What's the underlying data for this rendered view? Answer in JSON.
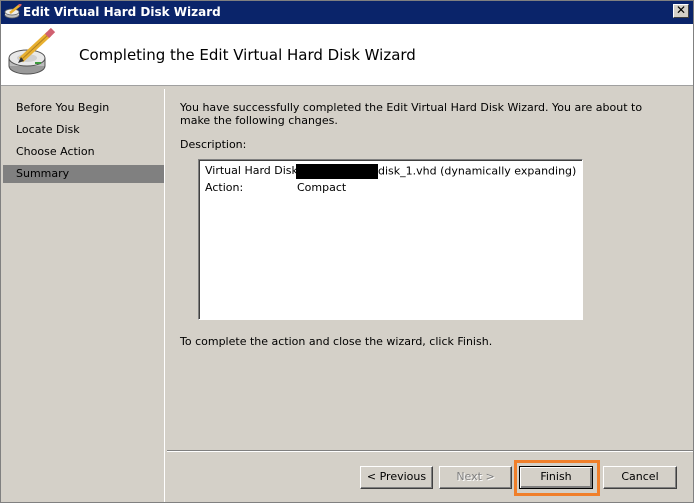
{
  "window": {
    "title": "Edit Virtual Hard Disk Wizard",
    "close_glyph": "✕"
  },
  "header": {
    "heading": "Completing the Edit Virtual Hard Disk Wizard"
  },
  "nav": {
    "items": [
      {
        "label": "Before You Begin",
        "selected": false
      },
      {
        "label": "Locate Disk",
        "selected": false
      },
      {
        "label": "Choose Action",
        "selected": false
      },
      {
        "label": "Summary",
        "selected": true
      }
    ]
  },
  "content": {
    "intro": "You have successfully completed the Edit Virtual Hard Disk Wizard. You are about to make the following changes.",
    "description_label": "Description:",
    "description": {
      "vhd_label": "Virtual Hard Disk:",
      "vhd_value_suffix": "disk_1.vhd (dynamically expanding)",
      "action_label": "Action:",
      "action_value": "Compact"
    },
    "footer_note": "To complete the action and close the wizard, click Finish."
  },
  "buttons": {
    "previous": "< Previous",
    "next": "Next >",
    "finish": "Finish",
    "cancel": "Cancel"
  },
  "colors": {
    "titlebar": "#0a246a",
    "highlight": "#f07f2a",
    "selected_nav": "#808080"
  },
  "icons": {
    "title_icon": "disk-pencil-icon",
    "header_icon": "hard-disk-pencil-icon"
  }
}
